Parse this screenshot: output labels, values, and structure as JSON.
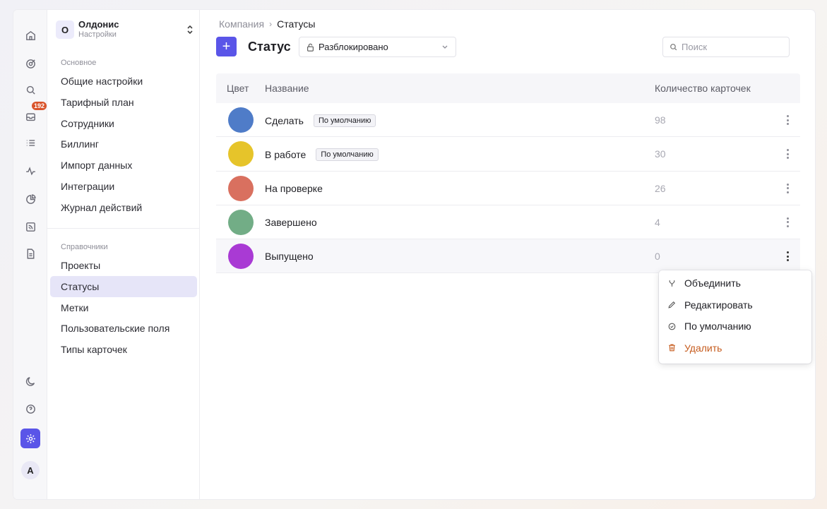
{
  "rail": {
    "inbox_badge": "192",
    "avatar_letter": "A"
  },
  "workspace": {
    "logo_letter": "О",
    "name": "Олдонис",
    "subtitle": "Настройки"
  },
  "sidebar": {
    "section_main": "Основное",
    "main_items": [
      {
        "label": "Общие настройки"
      },
      {
        "label": "Тарифный план"
      },
      {
        "label": "Сотрудники"
      },
      {
        "label": "Биллинг"
      },
      {
        "label": "Импорт данных"
      },
      {
        "label": "Интеграции"
      },
      {
        "label": "Журнал действий"
      }
    ],
    "section_refs": "Справочники",
    "ref_items": [
      {
        "label": "Проекты"
      },
      {
        "label": "Статусы",
        "active": true
      },
      {
        "label": "Метки"
      },
      {
        "label": "Пользовательские поля"
      },
      {
        "label": "Типы карточек"
      }
    ]
  },
  "breadcrumb": {
    "parent": "Компания",
    "separator": "›",
    "current": "Статусы"
  },
  "header": {
    "add_label": "+",
    "title": "Статус",
    "filter_value": "Разблокировано",
    "search_placeholder": "Поиск"
  },
  "table": {
    "columns": {
      "color": "Цвет",
      "name": "Название",
      "count": "Количество карточек"
    },
    "rows": [
      {
        "color": "#4f7cc8",
        "name": "Сделать",
        "tag": "По умолчанию",
        "count": "98"
      },
      {
        "color": "#e6c42a",
        "name": "В работе",
        "tag": "По умолчанию",
        "count": "30"
      },
      {
        "color": "#d9705f",
        "name": "На проверке",
        "tag": "",
        "count": "26"
      },
      {
        "color": "#72ad86",
        "name": "Завершено",
        "tag": "",
        "count": "4"
      },
      {
        "color": "#a93ad4",
        "name": "Выпущено",
        "tag": "",
        "count": "0"
      }
    ]
  },
  "context_menu": {
    "items": [
      {
        "label": "Объединить",
        "icon": "merge-icon"
      },
      {
        "label": "Редактировать",
        "icon": "pencil-icon"
      },
      {
        "label": "По умолчанию",
        "icon": "check-circle-icon"
      },
      {
        "label": "Удалить",
        "icon": "trash-icon",
        "color": "#c65b1d"
      }
    ]
  },
  "colors": {
    "accent": "#5a55e8",
    "danger": "#c65b1d",
    "badge": "#d9542b"
  }
}
